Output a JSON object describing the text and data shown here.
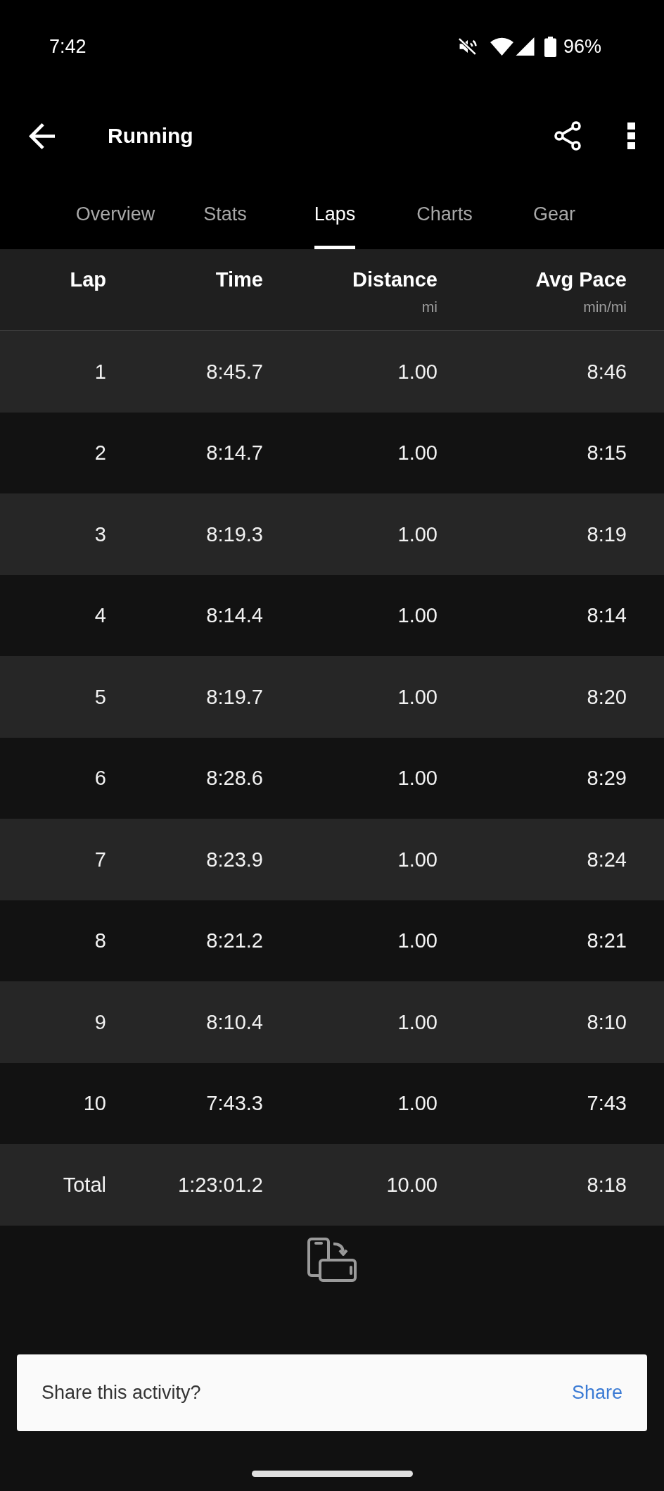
{
  "status_bar": {
    "time": "7:42",
    "battery": "96%"
  },
  "app_bar": {
    "title": "Running"
  },
  "tabs": [
    {
      "label": "Overview",
      "selected": false
    },
    {
      "label": "Stats",
      "selected": false
    },
    {
      "label": "Laps",
      "selected": true
    },
    {
      "label": "Charts",
      "selected": false
    },
    {
      "label": "Gear",
      "selected": false
    }
  ],
  "table": {
    "columns": [
      {
        "label": "Lap"
      },
      {
        "label": "Time"
      },
      {
        "label": "Distance",
        "unit": "mi"
      },
      {
        "label": "Avg Pace",
        "unit": "min/mi"
      }
    ],
    "rows": [
      [
        "1",
        "8:45.7",
        "1.00",
        "8:46"
      ],
      [
        "2",
        "8:14.7",
        "1.00",
        "8:15"
      ],
      [
        "3",
        "8:19.3",
        "1.00",
        "8:19"
      ],
      [
        "4",
        "8:14.4",
        "1.00",
        "8:14"
      ],
      [
        "5",
        "8:19.7",
        "1.00",
        "8:20"
      ],
      [
        "6",
        "8:28.6",
        "1.00",
        "8:29"
      ],
      [
        "7",
        "8:23.9",
        "1.00",
        "8:24"
      ],
      [
        "8",
        "8:21.2",
        "1.00",
        "8:21"
      ],
      [
        "9",
        "8:10.4",
        "1.00",
        "8:10"
      ],
      [
        "10",
        "7:43.3",
        "1.00",
        "7:43"
      ]
    ],
    "total_row": [
      "Total",
      "1:23:01.2",
      "10.00",
      "8:18"
    ]
  },
  "snackbar": {
    "message": "Share this activity?",
    "action": "Share"
  }
}
